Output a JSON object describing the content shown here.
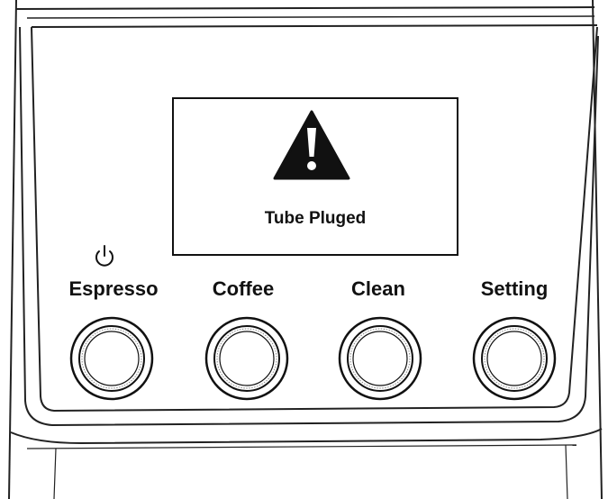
{
  "display": {
    "message": "Tube Pluged",
    "icon": "warning-triangle-icon"
  },
  "power_icon": "power-icon",
  "buttons": [
    {
      "label": "Espresso"
    },
    {
      "label": "Coffee"
    },
    {
      "label": "Clean"
    },
    {
      "label": "Setting"
    }
  ]
}
